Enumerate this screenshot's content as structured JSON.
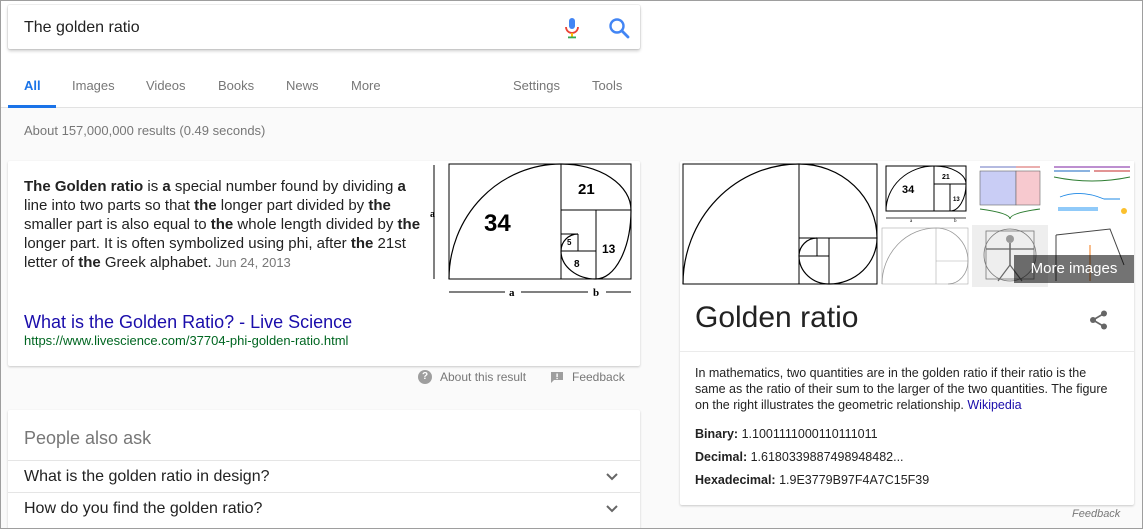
{
  "search": {
    "query": "The golden ratio"
  },
  "tabs": [
    {
      "label": "All"
    },
    {
      "label": "Images"
    },
    {
      "label": "Videos"
    },
    {
      "label": "Books"
    },
    {
      "label": "News"
    },
    {
      "label": "More"
    }
  ],
  "tools": {
    "settings": "Settings",
    "tools": "Tools"
  },
  "results_count": "About 157,000,000 results (0.49 seconds)",
  "featured_snippet": {
    "date": "Jun 24, 2013",
    "title": "What is the Golden Ratio? - Live Science",
    "url": "https://www.livescience.com/37704-phi-golden-ratio.html",
    "image_labels": {
      "a_side": "a",
      "a_bottom": "a",
      "b_bottom": "b",
      "n34": "34",
      "n21": "21",
      "n13": "13",
      "n8": "8",
      "n5": "5"
    }
  },
  "below_snippet": {
    "about": "About this result",
    "feedback": "Feedback"
  },
  "paa": {
    "title": "People also ask",
    "questions": [
      "What is the golden ratio in design?",
      "How do you find the golden ratio?"
    ]
  },
  "knowledge_panel": {
    "more_images": "More images",
    "title": "Golden ratio",
    "description": "In mathematics, two quantities are in the golden ratio if their ratio is the same as the ratio of their sum to the larger of the two quantities. The figure on the right illustrates the geometric relationship.",
    "source": "Wikipedia",
    "facts": [
      {
        "label": "Binary:",
        "value": "1.1001111000110111011"
      },
      {
        "label": "Decimal:",
        "value": "1.6180339887498948482..."
      },
      {
        "label": "Hexadecimal:",
        "value": "1.9E3779B97F4A7C15F39"
      }
    ],
    "thumb_labels": {
      "n34": "34",
      "n21": "21",
      "n13": "13",
      "a": "a",
      "b": "b"
    },
    "feedback": "Feedback"
  },
  "colors": {
    "accent": "#1a73e8",
    "link": "#1a0dab",
    "url": "#006621",
    "muted": "#777777"
  }
}
